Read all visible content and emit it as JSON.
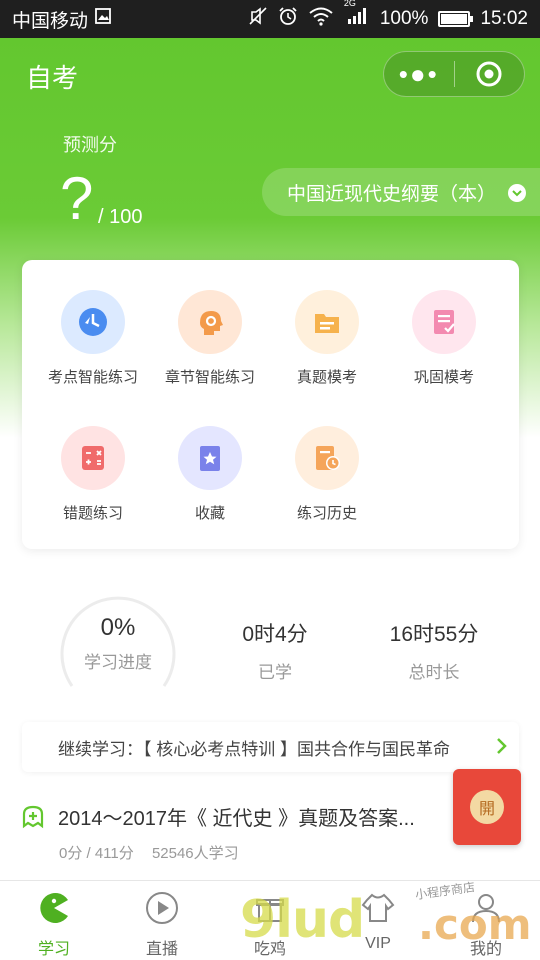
{
  "status_bar": {
    "carrier": "中国移动",
    "battery": "100%",
    "battery_fill": 1.0,
    "time": "15:02",
    "network": "2G"
  },
  "header": {
    "title": "自考",
    "menu_icon": "more-dots-icon",
    "close_icon": "target-icon"
  },
  "prediction": {
    "label": "预测分",
    "value": "?",
    "total": "/ 100"
  },
  "subject": {
    "name": "中国近现代史纲要（本）"
  },
  "features": [
    {
      "label": "考点智能练习",
      "icon": "lightning-clock-icon",
      "bg": "#dceaff",
      "fg": "#4a8cf0"
    },
    {
      "label": "章节智能练习",
      "icon": "brain-gear-icon",
      "bg": "#ffe7d6",
      "fg": "#f39a4a"
    },
    {
      "label": "真题模考",
      "icon": "folder-icon",
      "bg": "#fff0dc",
      "fg": "#f6b24d"
    },
    {
      "label": "巩固模考",
      "icon": "checklist-icon",
      "bg": "#ffe6ee",
      "fg": "#f38ab0"
    },
    {
      "label": "错题练习",
      "icon": "calculator-icon",
      "bg": "#ffe3e3",
      "fg": "#f06b6b"
    },
    {
      "label": "收藏",
      "icon": "star-book-icon",
      "bg": "#e4e6ff",
      "fg": "#7a82ea"
    },
    {
      "label": "练习历史",
      "icon": "history-clock-icon",
      "bg": "#ffeedd",
      "fg": "#f5a55a"
    }
  ],
  "stats": {
    "progress_value": "0%",
    "progress_label": "学习进度",
    "progress_fraction": 0,
    "studied_value": "0时4分",
    "studied_label": "已学",
    "total_value": "16时55分",
    "total_label": "总时长"
  },
  "continue": {
    "text": "继续学习：【 核心必考点特训 】国共合作与国民革命"
  },
  "float_button": {
    "label": "開"
  },
  "course": {
    "title": "2014～2017年《 近代史 》真题及答案...",
    "score": "0分 / 411分",
    "learners": "52546人学习"
  },
  "tabs": [
    {
      "label": "学习",
      "icon": "pacman-icon",
      "active": true
    },
    {
      "label": "直播",
      "icon": "play-circle-icon",
      "active": false
    },
    {
      "label": "吃鸡",
      "icon": "gift-icon",
      "active": false
    },
    {
      "label": "VIP",
      "icon": "shirt-icon",
      "active": false
    },
    {
      "label": "我的",
      "icon": "user-icon",
      "active": false
    }
  ],
  "watermark": {
    "main": "9lud",
    "suffix": ".com",
    "small": "小程序商店"
  },
  "colors": {
    "brand_green": "#63c72f",
    "active_tab": "#4fb021",
    "red_button": "#e8483a"
  }
}
